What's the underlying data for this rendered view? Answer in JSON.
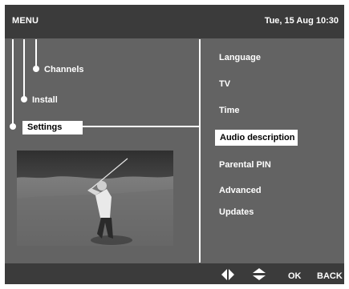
{
  "header": {
    "title": "MENU",
    "datetime": "Tue, 15 Aug 10:30"
  },
  "tree": {
    "items": [
      {
        "label": "Channels"
      },
      {
        "label": "Install"
      },
      {
        "label": "Settings",
        "selected": true
      }
    ]
  },
  "submenu": {
    "items": [
      {
        "label": "Language"
      },
      {
        "label": "TV"
      },
      {
        "label": "Time"
      },
      {
        "label": "Audio description",
        "selected": true
      },
      {
        "label": "Parental PIN"
      },
      {
        "label": "Advanced"
      },
      {
        "label": "Updates"
      }
    ]
  },
  "footer": {
    "icons": [
      "left-right-arrows-icon",
      "up-down-arrows-icon"
    ],
    "ok_label": "OK",
    "back_label": "BACK"
  },
  "colors": {
    "panel": "#636363",
    "bar": "#3b3b3b",
    "highlight": "#ffffff",
    "text": "#ffffff",
    "selected_text": "#000000"
  }
}
